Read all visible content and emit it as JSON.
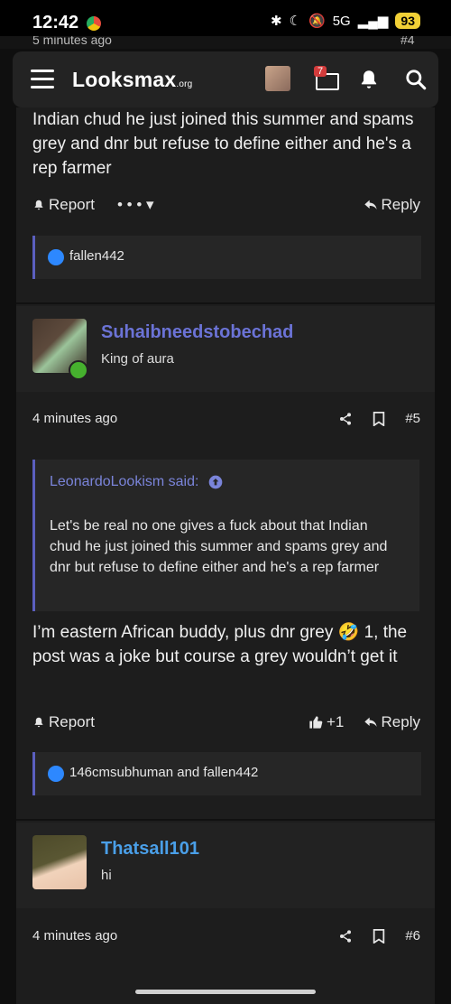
{
  "status_bar": {
    "time": "12:42",
    "battery": "93",
    "network": "5G"
  },
  "peek_row": {
    "time_partial": "5 minutes ago",
    "post_number": "#4"
  },
  "navbar": {
    "logo": "Looksmax",
    "logo_suffix": ".org",
    "mail_badge": "7"
  },
  "post1": {
    "text": "Indian chud he just joined this summer and spams grey and dnr but refuse to define either and he's a rep farmer",
    "report_label": "Report",
    "more_label": "• • • ▾",
    "reply_label": "Reply",
    "reactions": "fallen442"
  },
  "post2": {
    "username": "Suhaibneedstobechad",
    "user_title": "King of aura",
    "time": "4 minutes ago",
    "post_number": "#5",
    "quote_author": "LeonardoLookism said:",
    "quote_text": "Let's be real no one gives a fuck about that Indian chud he just joined this summer and spams grey and dnr but refuse to define either and he's a rep farmer",
    "text": "I’m eastern African buddy, plus dnr grey 🤣 1, the post was a joke but course a grey wouldn’t get it",
    "report_label": "Report",
    "plus_one": "+1",
    "reply_label": "Reply",
    "reactions": "146cmsubhuman and fallen442"
  },
  "post3": {
    "username": "Thatsall101",
    "user_title": "hi",
    "time": "4 minutes ago",
    "post_number": "#6"
  },
  "colors": {
    "username_purple": "#6b73d6",
    "username_blue": "#4a9fe8",
    "quote_border": "#5b5fbf",
    "online": "#46b12e"
  }
}
